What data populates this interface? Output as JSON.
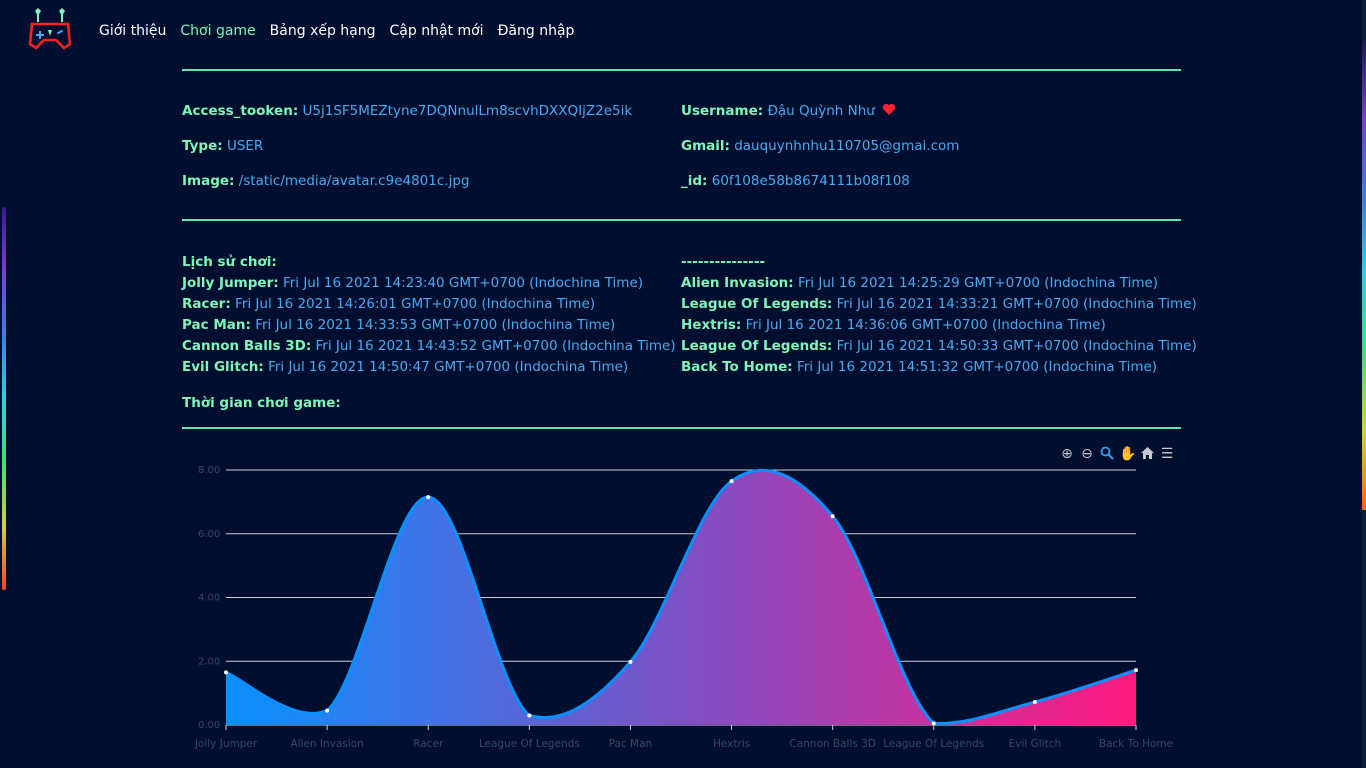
{
  "nav": {
    "items": [
      {
        "label": "Giới thiệu",
        "active": false
      },
      {
        "label": "Chơi game",
        "active": true
      },
      {
        "label": "Bảng xếp hạng",
        "active": false
      },
      {
        "label": "Cập nhật mới",
        "active": false
      },
      {
        "label": "Đăng nhập",
        "active": false
      }
    ]
  },
  "account": {
    "access_token_label": "Access_tooken:",
    "access_token": "U5j1SF5MEZtyne7DQNnulLm8scvhDXXQIjZ2e5ik",
    "type_label": "Type:",
    "type": "USER",
    "image_label": "Image:",
    "image": "/static/media/avatar.c9e4801c.jpg",
    "username_label": "Username:",
    "username": "Đậu Quỳnh Như",
    "gmail_label": "Gmail:",
    "gmail": "dauquynhnhu110705@gmai.com",
    "id_label": "_id:",
    "id": "60f108e58b8674111b08f108"
  },
  "history": {
    "title": "Lịch sử chơi:",
    "divider": "---------------",
    "left": [
      {
        "game": "Jolly Jumper:",
        "time": "Fri Jul 16 2021 14:23:40 GMT+0700 (Indochina Time)"
      },
      {
        "game": "Racer:",
        "time": "Fri Jul 16 2021 14:26:01 GMT+0700 (Indochina Time)"
      },
      {
        "game": "Pac Man:",
        "time": "Fri Jul 16 2021 14:33:53 GMT+0700 (Indochina Time)"
      },
      {
        "game": "Cannon Balls 3D:",
        "time": "Fri Jul 16 2021 14:43:52 GMT+0700 (Indochina Time)"
      },
      {
        "game": "Evil Glitch:",
        "time": "Fri Jul 16 2021 14:50:47 GMT+0700 (Indochina Time)"
      }
    ],
    "right": [
      {
        "game": "Alien Invasion:",
        "time": "Fri Jul 16 2021 14:25:29 GMT+0700 (Indochina Time)"
      },
      {
        "game": "League Of Legends:",
        "time": "Fri Jul 16 2021 14:33:21 GMT+0700 (Indochina Time)"
      },
      {
        "game": "Hextris:",
        "time": "Fri Jul 16 2021 14:36:06 GMT+0700 (Indochina Time)"
      },
      {
        "game": "League Of Legends:",
        "time": "Fri Jul 16 2021 14:50:33 GMT+0700 (Indochina Time)"
      },
      {
        "game": "Back To Home:",
        "time": "Fri Jul 16 2021 14:51:32 GMT+0700 (Indochina Time)"
      }
    ],
    "playtime_label": "Thời gian chơi game:"
  },
  "toolbar": {
    "icons": [
      "zoom-in-icon",
      "zoom-out-icon",
      "selection-zoom-icon",
      "pan-icon",
      "home-reset-icon",
      "menu-icon"
    ]
  },
  "colors": {
    "accent": "#7ff5b8",
    "value": "#4aa8f0",
    "background": "#000f2f",
    "chart_start": "#0a90ff",
    "chart_end": "#ff1a80",
    "line": "#0a90ff"
  },
  "chart_data": {
    "type": "area",
    "categories": [
      "Jolly Jumper",
      "Alien Invasion",
      "Racer",
      "League Of Legends",
      "Pac Man",
      "Hextris",
      "Cannon Balls 3D",
      "League Of Legends",
      "Evil Glitch",
      "Back To Home"
    ],
    "values": [
      1.65,
      0.45,
      7.15,
      0.3,
      1.98,
      7.65,
      6.55,
      0.05,
      0.72,
      1.72
    ],
    "yticks": [
      "0.00",
      "2.00",
      "4.00",
      "6.00",
      "8.00"
    ],
    "ylim": [
      0,
      8
    ],
    "grid": true,
    "curve": "smooth"
  }
}
